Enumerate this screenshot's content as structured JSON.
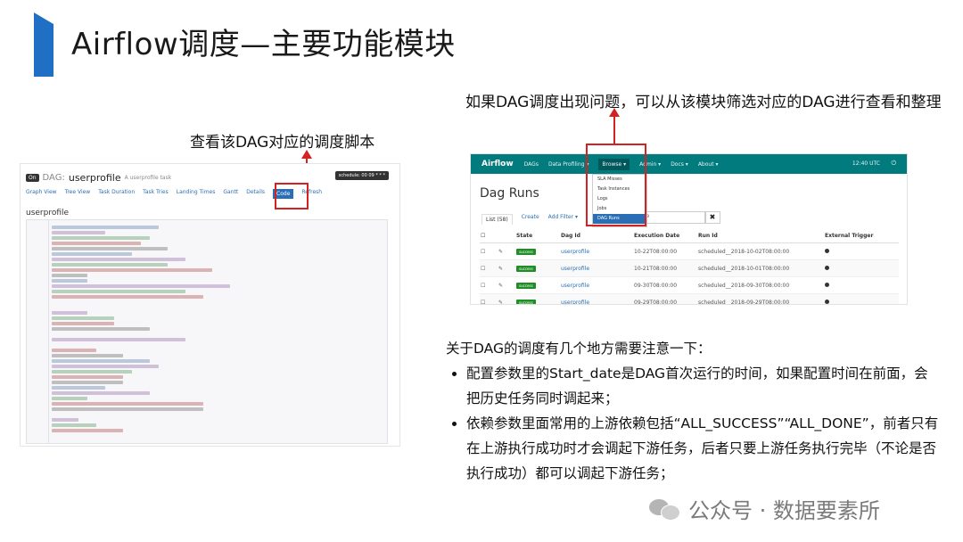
{
  "slide": {
    "title": "Airflow调度—主要功能模块",
    "caption_left": "查看该DAG对应的调度脚本",
    "caption_right": "如果DAG调度出现问题，可以从该模块筛选对应的DAG进行查看和整理",
    "accent_color": "#1f6fc4",
    "highlight_color": "#d32222"
  },
  "left_screenshot": {
    "on_badge": "On",
    "dag_word": "DAG:",
    "dag_name": "userprofile",
    "dag_desc": "A userprofile task",
    "schedule": "schedule: 00 09 * * *",
    "tabs": [
      "Graph View",
      "Tree View",
      "Task Duration",
      "Task Tries",
      "Landing Times",
      "Gantt",
      "Details",
      "Code",
      "Refresh"
    ],
    "active_tab": "Code",
    "heading": "userprofile"
  },
  "right_screenshot": {
    "logo": "Airflow",
    "nav": [
      "DAGs",
      "Data Profiling ▾",
      "Browse ▾",
      "Admin ▾",
      "Docs ▾",
      "About ▾"
    ],
    "active_nav": "Browse ▾",
    "utc": "12:40 UTC",
    "page_title": "Dag Runs",
    "tabs": [
      "List (58)",
      "Create",
      "Add Filter ▾"
    ],
    "search_value": "rofile",
    "clear_label": "✖",
    "browse_menu": [
      "SLA Misses",
      "Task Instances",
      "Logs",
      "Jobs",
      "DAG Runs"
    ],
    "browse_selected": "DAG Runs",
    "columns": [
      "",
      "",
      "State",
      "Dag Id",
      "Execution Date",
      "Run Id",
      "External Trigger"
    ],
    "rows": [
      {
        "state": "success",
        "dag_id": "userprofile",
        "exec_date": "10-22T08:00:00",
        "run_id": "scheduled__2018-10-02T08:00:00"
      },
      {
        "state": "success",
        "dag_id": "userprofile",
        "exec_date": "10-21T08:00:00",
        "run_id": "scheduled__2018-10-01T08:00:00"
      },
      {
        "state": "success",
        "dag_id": "userprofile",
        "exec_date": "09-30T08:00:00",
        "run_id": "scheduled__2018-09-30T08:00:00"
      },
      {
        "state": "success",
        "dag_id": "userprofile",
        "exec_date": "09-29T08:00:00",
        "run_id": "scheduled__2018-09-29T08:00:00"
      }
    ]
  },
  "notes": {
    "intro": "关于DAG的调度有几个地方需要注意一下：",
    "bullets": [
      "配置参数里的Start_date是DAG首次运行的时间，如果配置时间在前面，会把历史任务同时调起来；",
      "依赖参数里面常用的上游依赖包括“ALL_SUCCESS”“ALL_DONE”，前者只有在上游执行成功时才会调起下游任务，后者只要上游任务执行完毕（不论是否执行成功）都可以调起下游任务；"
    ]
  },
  "watermark": "公众号 · 数据要素所"
}
